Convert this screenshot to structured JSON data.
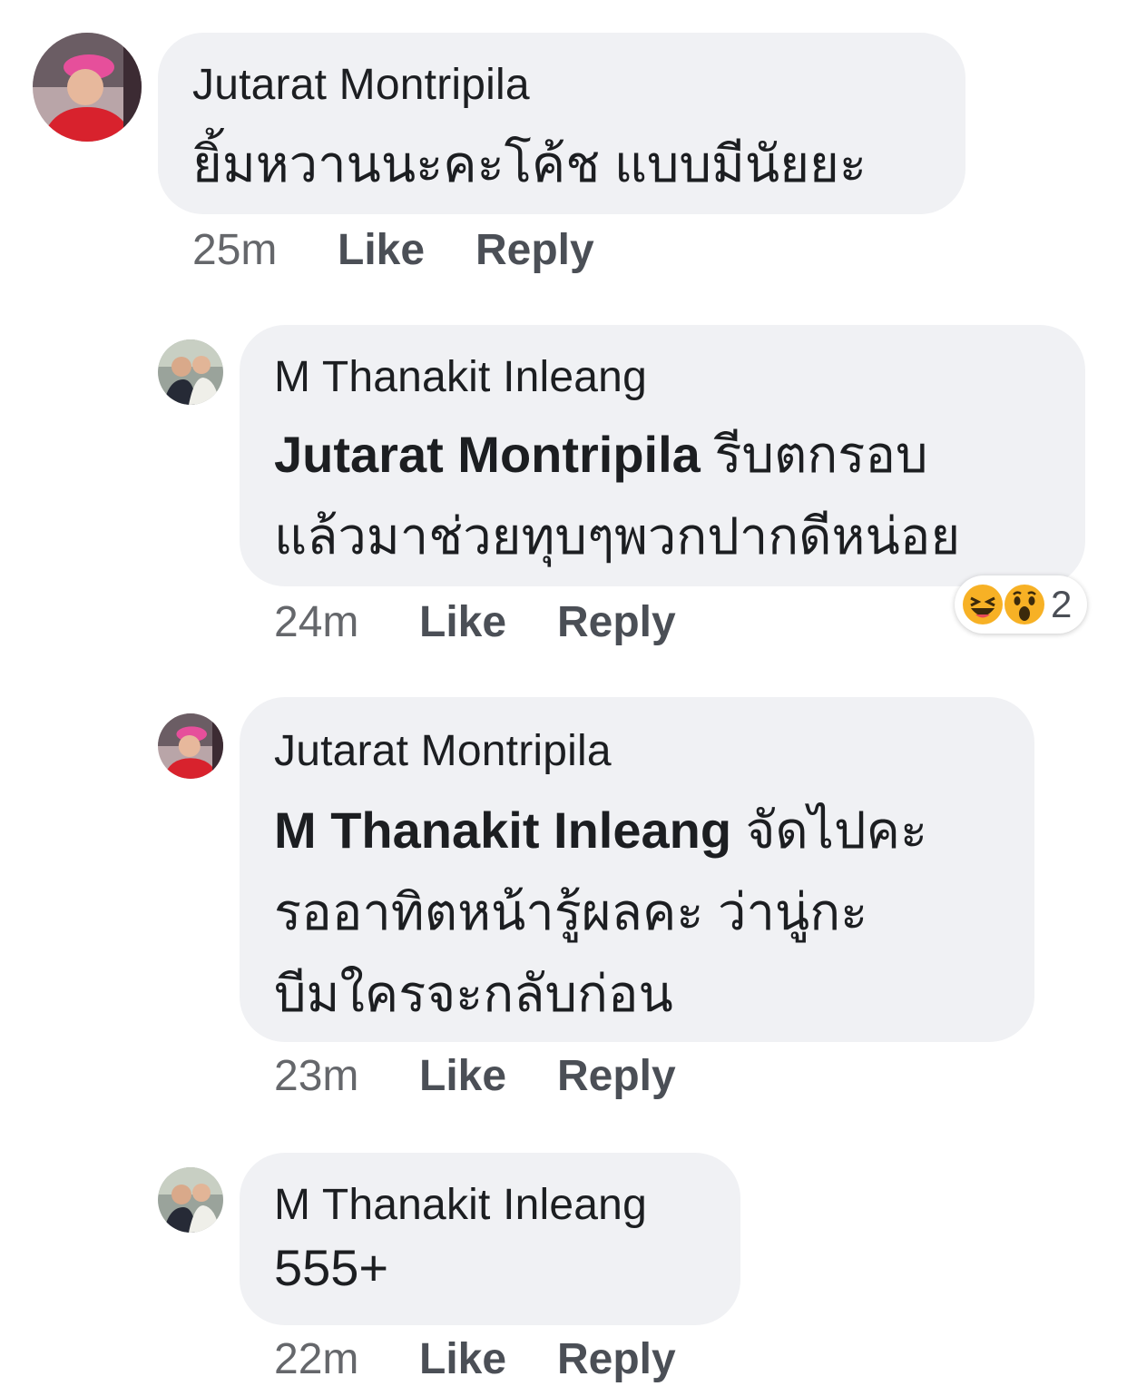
{
  "comments": [
    {
      "author": "Jutarat Montripila",
      "mention": "",
      "lines": [
        "ยิ้มหวานนะคะโค้ช แบบมีนัยยะ"
      ],
      "time": "25m",
      "like_label": "Like",
      "reply_label": "Reply"
    },
    {
      "author": "M Thanakit Inleang",
      "mention": "Jutarat Montripila",
      "lines": [
        " รีบตกรอบ",
        "แล้วมาช่วยทุบๆพวกปากดีหน่อย"
      ],
      "time": "24m",
      "like_label": "Like",
      "reply_label": "Reply",
      "reactions": {
        "emojis": [
          "laugh-reaction-icon",
          "wow-reaction-icon"
        ],
        "count": "2"
      }
    },
    {
      "author": "Jutarat Montripila",
      "mention": "M Thanakit Inleang",
      "lines": [
        " จัดไปคะ",
        "รออาทิตหน้ารู้ผลคะ ว่านู่กะ",
        "บีมใครจะกลับก่อน"
      ],
      "time": "23m",
      "like_label": "Like",
      "reply_label": "Reply"
    },
    {
      "author": "M Thanakit Inleang",
      "mention": "",
      "lines": [
        "555+"
      ],
      "time": "22m",
      "like_label": "Like",
      "reply_label": "Reply"
    }
  ],
  "colors": {
    "bubble": "#f0f1f4",
    "meta_time": "#65676b",
    "meta_action": "#4b4f56",
    "reaction_face": "#f7b125"
  }
}
